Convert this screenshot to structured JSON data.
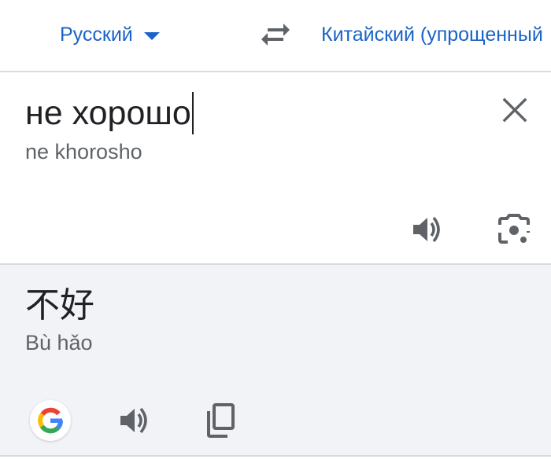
{
  "language_bar": {
    "source_language": "Русский",
    "target_language": "Китайский (упрощенный)",
    "swap_icon": "swap-arrows-icon",
    "caret_icon": "chevron-down-icon"
  },
  "source": {
    "text": "не хорошо",
    "transliteration": "ne khorosho",
    "icons": {
      "clear": "close-icon",
      "speak": "speaker-icon",
      "camera": "camera-lens-icon"
    }
  },
  "result": {
    "text": "不好",
    "transliteration": "Bù hǎo",
    "icons": {
      "google": "google-logo-icon",
      "speak": "speaker-icon",
      "copy": "copy-icon"
    }
  },
  "colors": {
    "accent": "#1a63c7",
    "text_primary": "#202124",
    "text_secondary": "#5f6368",
    "icon": "#5f6368",
    "result_background": "#f1f3f6",
    "divider": "#d8dadd"
  }
}
